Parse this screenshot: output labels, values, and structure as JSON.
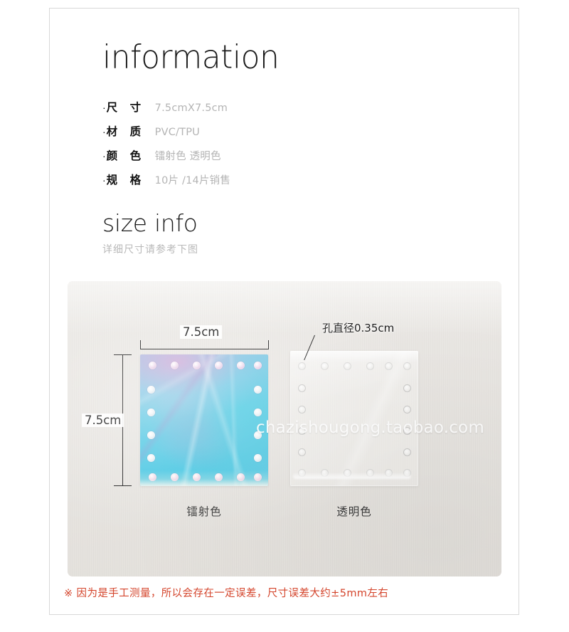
{
  "info": {
    "heading": "information",
    "specs": [
      {
        "bullet": "·",
        "label": "尺 寸",
        "value": "7.5cmX7.5cm"
      },
      {
        "bullet": "·",
        "label": "材 质",
        "value": "PVC/TPU"
      },
      {
        "bullet": "·",
        "label": "颜 色",
        "value": "镭射色  透明色"
      },
      {
        "bullet": "·",
        "label": "规 格",
        "value": "10片 /14片销售"
      }
    ]
  },
  "size_info": {
    "heading": "size info",
    "subtitle": "详细尺寸请参考下图"
  },
  "photo": {
    "dimension_width_label": "7.5cm",
    "dimension_height_label": "7.5cm",
    "hole_callout": "孔直径0.35cm",
    "watermark": "chazishougong.taobao.com",
    "captions": {
      "holographic": "镭射色",
      "transparent": "透明色"
    }
  },
  "bottom_note": "※ 因为是手工测量，所以会存在一定误差，尺寸误差大约±5mm左右",
  "colors": {
    "frame_border": "#d8d8d8",
    "label_text": "#111111",
    "value_text": "#b4b4b4",
    "note_red": "#d4452c",
    "holo_cyan": "#4fc7e3",
    "holo_violet": "#d6a6d6",
    "photo_bg": "#e8e5e1"
  }
}
